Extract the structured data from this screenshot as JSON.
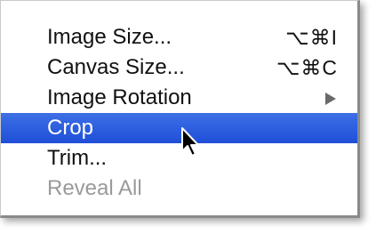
{
  "menu": {
    "items": [
      {
        "label": "Image Size...",
        "shortcut": "⌥⌘I",
        "state": "normal"
      },
      {
        "label": "Canvas Size...",
        "shortcut": "⌥⌘C",
        "state": "normal"
      },
      {
        "label": "Image Rotation",
        "submenu": true,
        "state": "normal"
      },
      {
        "label": "Crop",
        "state": "selected"
      },
      {
        "label": "Trim...",
        "state": "normal"
      },
      {
        "label": "Reveal All",
        "state": "disabled"
      }
    ]
  },
  "colors": {
    "selection": "#2a5be0",
    "disabled_text": "#9a9a9a"
  },
  "cursor": {
    "icon": "arrow-cursor-icon"
  }
}
